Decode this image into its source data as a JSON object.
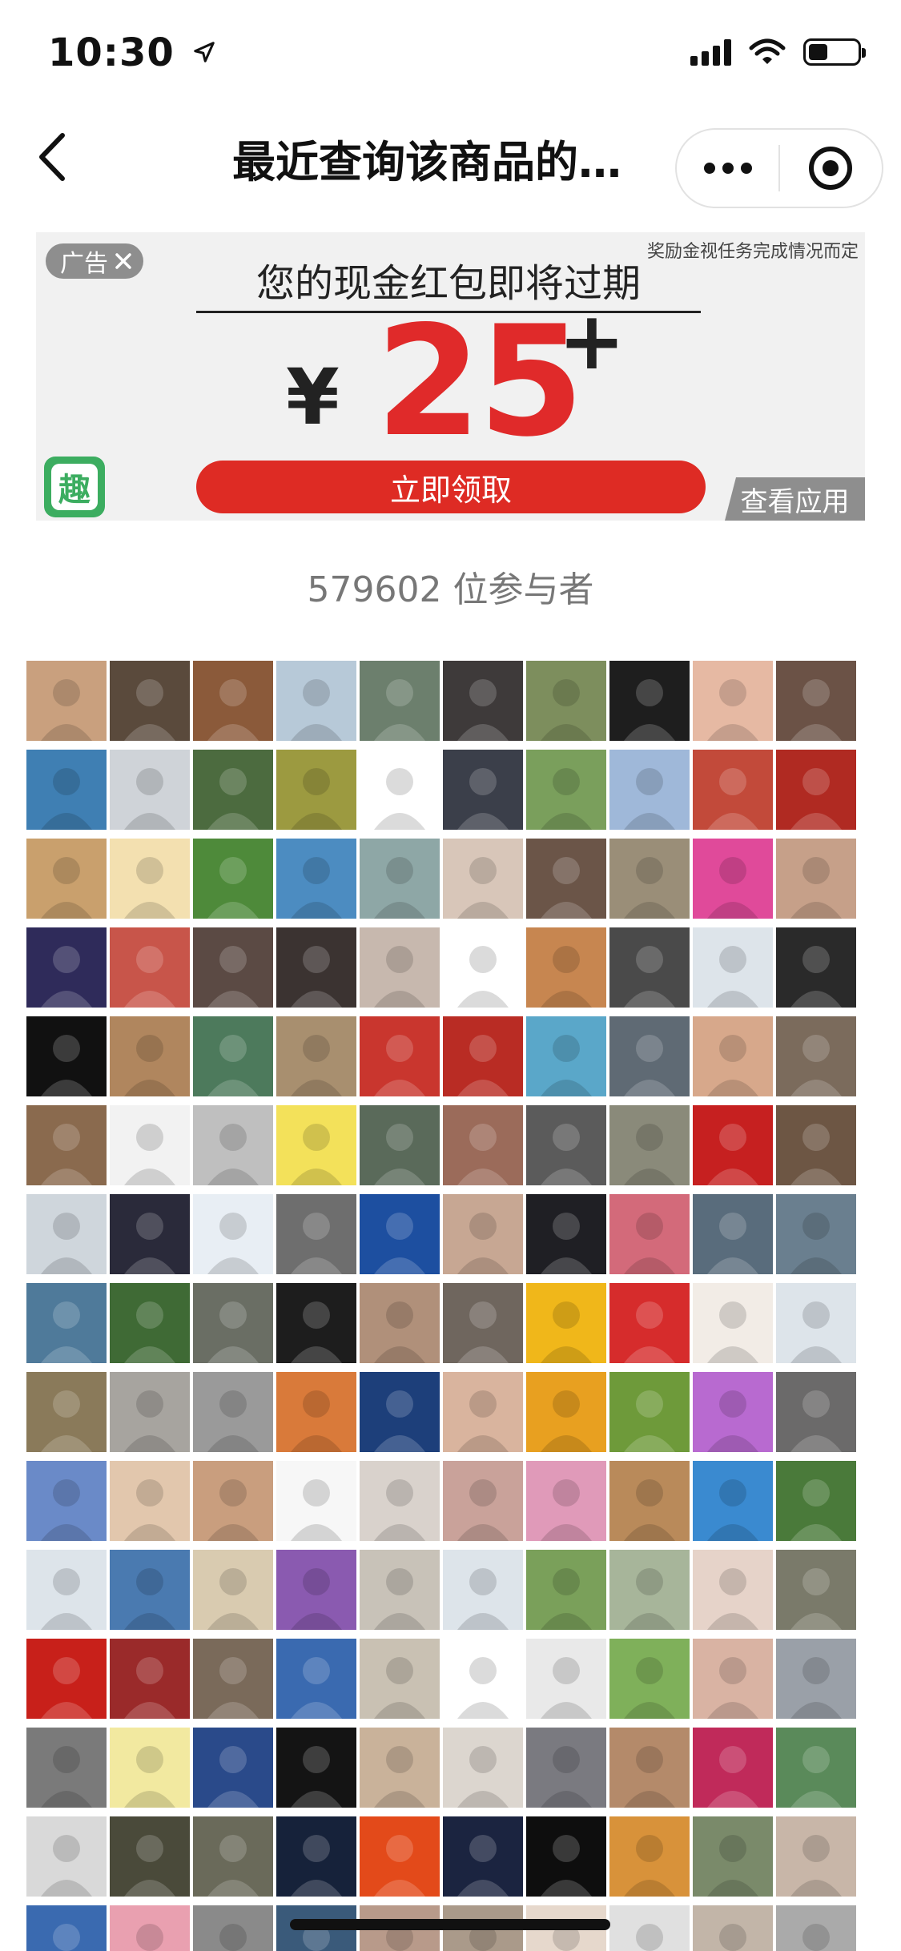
{
  "status_bar": {
    "time": "10:30",
    "icons": [
      "location-arrow-icon",
      "cellular-signal-icon",
      "wifi-icon",
      "battery-icon"
    ],
    "battery_level": 0.4
  },
  "nav": {
    "title": "最近查询该商品的…",
    "icons": [
      "back-chevron-icon",
      "more-dots-icon",
      "close-target-icon"
    ]
  },
  "ad": {
    "tag": "广告",
    "reward_note": "奖励金视任务完成情况而定",
    "headline": "您的现金红包即将过期",
    "currency": "¥",
    "amount": "25",
    "plus": "+",
    "logo_char": "趣",
    "cta": "立即领取",
    "view_app": "查看应用",
    "colors": {
      "accent_red": "#de2b24",
      "amount_red": "#e02a2a",
      "tag_grey": "#8e8e8e",
      "logo_green": "#3cad60",
      "banner_bg": "#f1f1f1"
    }
  },
  "participants": {
    "text": "579602 位参与者"
  },
  "avatars": {
    "columns": 10,
    "rows": 15,
    "palette": [
      "#c9a07e",
      "#5a4a3c",
      "#8b5a3a",
      "#b7c9d8",
      "#6c7f6d",
      "#3e3a3a",
      "#7d8e5d",
      "#1e1e1e",
      "#e6b9a3",
      "#6b5246",
      "#3f7fb3",
      "#cfd3d8",
      "#4c6b3f",
      "#9c9a40",
      "#ffffff",
      "#3b3f4a",
      "#7a9f5c",
      "#9fb8d9",
      "#c24a3a",
      "#b02a22",
      "#c9a06d",
      "#f3e0b0",
      "#4e8a3a",
      "#4c8cc1",
      "#8ea7a6",
      "#d8c6b9",
      "#6b5548",
      "#9a8e78",
      "#e04a9a",
      "#c6a089",
      "#2f2b5a",
      "#c8554a",
      "#5b4a44",
      "#3b3331",
      "#c7b8ae",
      "#ffffff",
      "#c78650",
      "#4a4a4a",
      "#dde4ea",
      "#2a2a2a",
      "#111111",
      "#b0865e",
      "#4d7a5c",
      "#a88f6f",
      "#c9362e",
      "#b92c24",
      "#5aa7c9",
      "#5f6a74",
      "#d7a88b",
      "#7b6b5c",
      "#8a6a4e",
      "#f2f2f2",
      "#bfbfbf",
      "#f3e15a",
      "#5a6a5a",
      "#9b6b5a",
      "#5b5b5b",
      "#8a8a7a",
      "#c62020",
      "#6d5644",
      "#cfd6dc",
      "#2a2a3a",
      "#e8eef4",
      "#6e6e6e",
      "#1d4fa0",
      "#c7a793",
      "#1f1f24",
      "#d36a7a",
      "#596c7c",
      "#6a7f8f",
      "#4f7a9a",
      "#3f6a35",
      "#6a6e64",
      "#1d1d1d",
      "#b0907a",
      "#6f665e",
      "#f0b71a",
      "#d62c2c",
      "#f2ece6",
      "#dde4ea",
      "#8a7a5a",
      "#a7a49f",
      "#9a9a9a",
      "#d97a3a",
      "#1d3f7a",
      "#d9b49e",
      "#e8a020",
      "#6e9a3a",
      "#b86ad0",
      "#6b6a6a",
      "#6a8ac8",
      "#e2c7ad",
      "#c99e7e",
      "#f7f7f7",
      "#d9d2cc",
      "#c9a29a",
      "#e09ab9",
      "#b98a5a",
      "#3a8ad0",
      "#4a7a3a",
      "#dde4ea",
      "#4a7ab0",
      "#d9cbb0",
      "#8a5ab0",
      "#c8c2b8",
      "#dde4ea",
      "#7aa05a",
      "#a7b59a",
      "#e6d3c9",
      "#7a7a6a",
      "#c8201a",
      "#9a2a2a",
      "#7a6a5a",
      "#3a6ab0",
      "#c9c1b3",
      "#ffffff",
      "#e9e9e9",
      "#7fb05a",
      "#d9b3a3",
      "#9aa0a8",
      "#7a7a7a",
      "#f2e9a0",
      "#2a4a8a",
      "#141414",
      "#c9b29a",
      "#dcd6cf",
      "#7a7a80",
      "#b48a6a",
      "#c02a5a",
      "#5a8a5a",
      "#d9d9d9",
      "#4a4a3a",
      "#6a6a5a",
      "#16223a",
      "#e34a1a",
      "#1b2440",
      "#0e0e0e",
      "#d8923a",
      "#7a8a6a",
      "#c8b6a8",
      "#3a6ab0",
      "#e9a0b0",
      "#8a8a8a",
      "#3a5a7a",
      "#b89a8a",
      "#aa9a8a",
      "#e6d8cc",
      "#e0e0e0",
      "#c2b5a8",
      "#aaaaaa"
    ]
  }
}
